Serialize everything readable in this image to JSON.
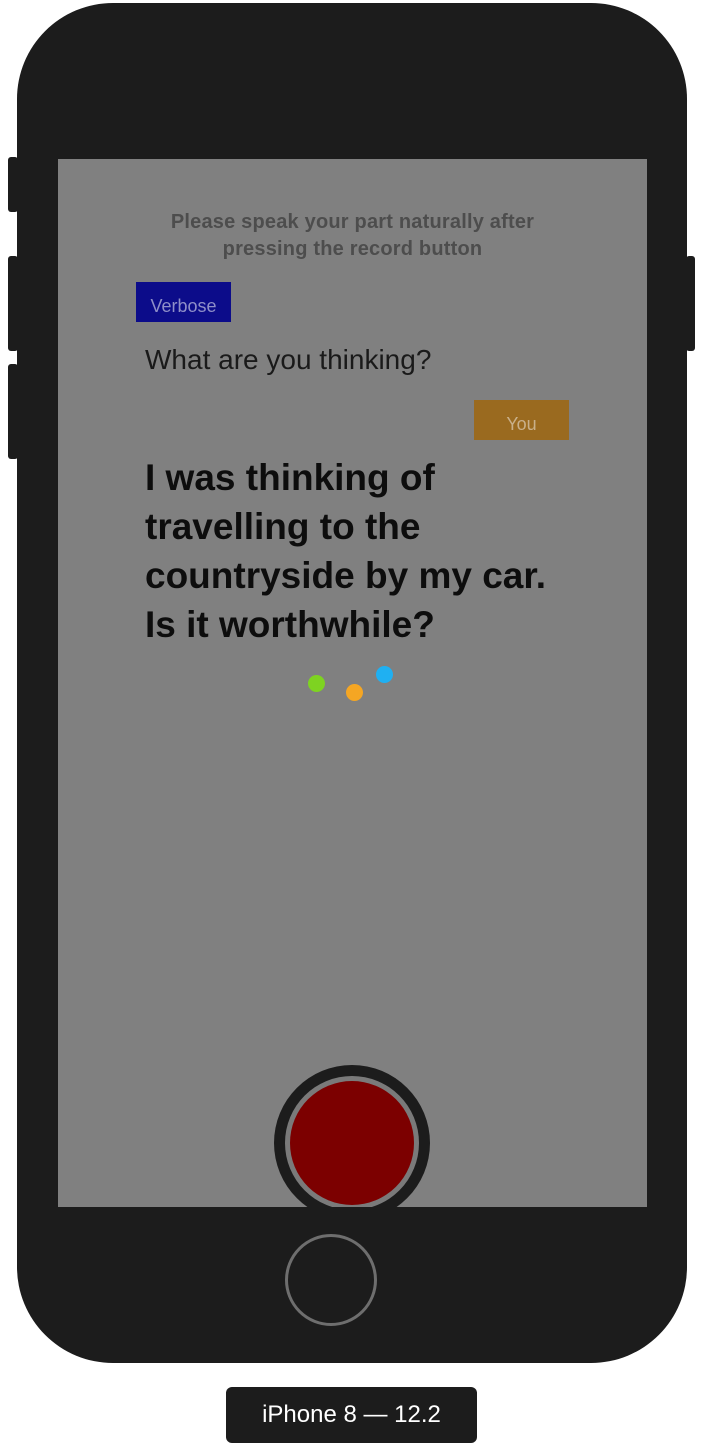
{
  "screen": {
    "instruction_line1": "Please speak your part naturally after",
    "instruction_line2": "pressing the record button",
    "verbose_tag": "Verbose",
    "question": "What are you thinking?",
    "you_tag": "You",
    "answer_lines": [
      "I was thinking of",
      "travelling to the",
      "countryside by my car.",
      "Is it worthwhile?"
    ],
    "loading_dots": [
      {
        "name": "green",
        "color": "#7ed321"
      },
      {
        "name": "orange",
        "color": "#f5a623"
      },
      {
        "name": "blue",
        "color": "#1fb0f2"
      }
    ]
  },
  "colors": {
    "screen_background": "#808080",
    "verbose_tag_background": "#0c0c8a",
    "you_tag_background": "#9a6a1f",
    "record_button": "#7c0000",
    "device_body": "#1c1c1c"
  },
  "device": {
    "label": "iPhone 8 — 12.2"
  }
}
